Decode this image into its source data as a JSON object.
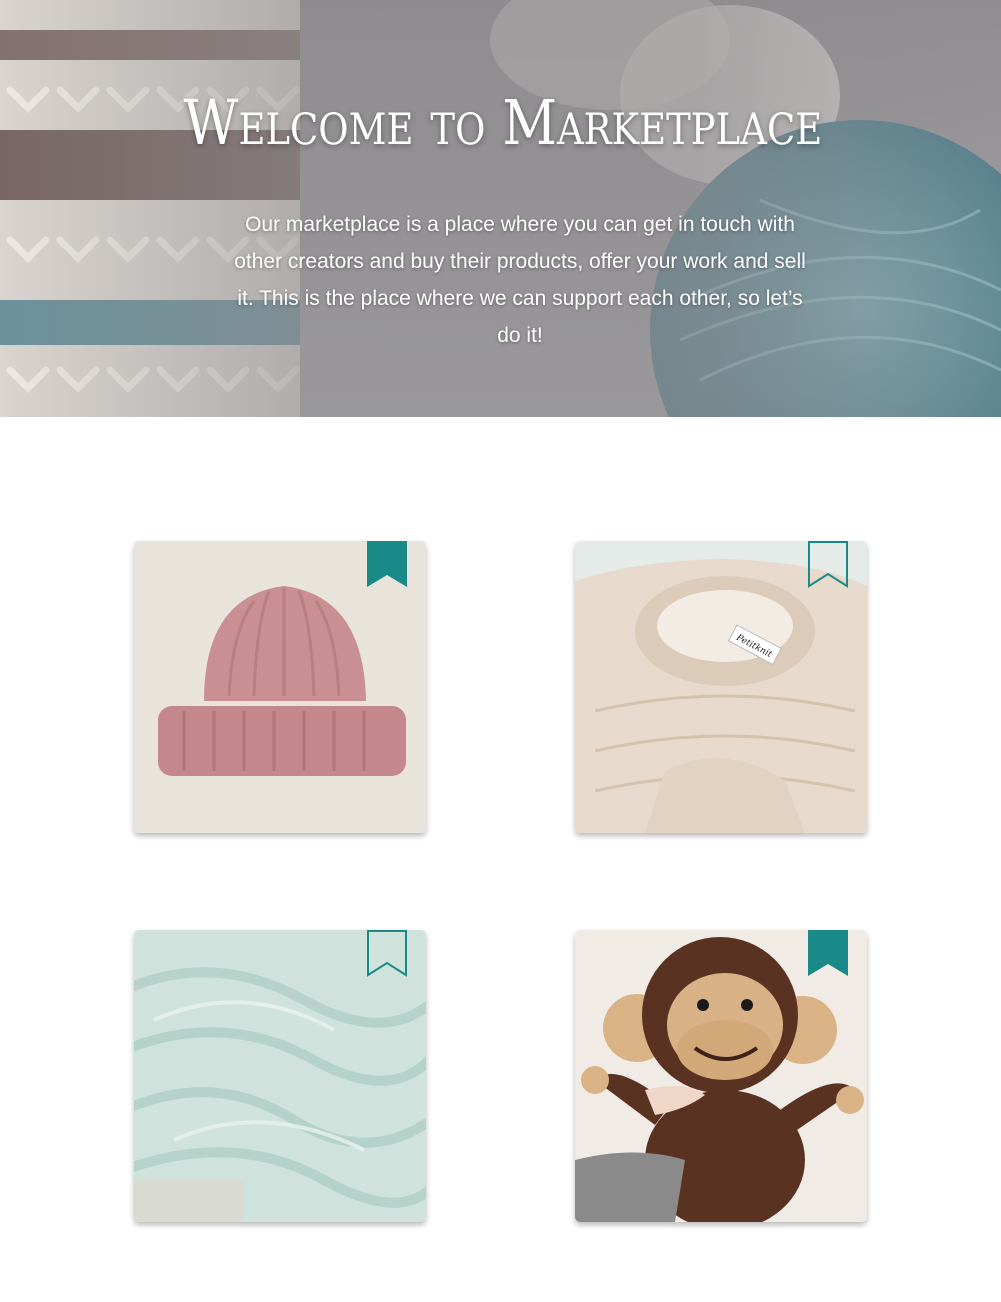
{
  "hero": {
    "title": "Welcome to Marketplace",
    "description": "Our marketplace is a place where you can get in touch with other creators and buy their products, offer your work and sell it. This is the place where we can support each other, so let’s do it!"
  },
  "colors": {
    "accent": "#1a8a88",
    "title_text": "#ffffff",
    "page_background": "#ffffff"
  },
  "products": [
    {
      "subject": "pink knitted beanie",
      "bookmarked": true,
      "icon": "bookmark-filled-icon"
    },
    {
      "subject": "cream knitted sweater",
      "label_text": "Petitknit",
      "bookmarked": false,
      "icon": "bookmark-outline-icon"
    },
    {
      "subject": "mint knitted blanket",
      "bookmarked": false,
      "icon": "bookmark-outline-icon"
    },
    {
      "subject": "crochet monkey toy",
      "bookmarked": true,
      "icon": "bookmark-filled-icon"
    }
  ]
}
